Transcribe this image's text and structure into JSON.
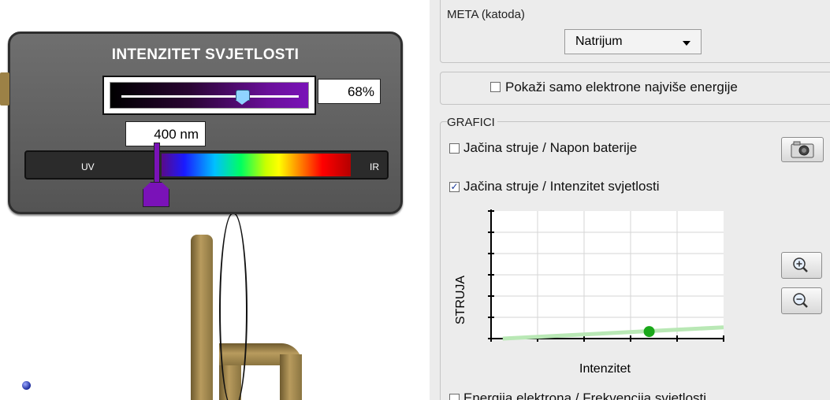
{
  "light_panel": {
    "title": "INTENZITET SVJETLOSTI",
    "intensity_value": "68%",
    "intensity_level": 0.68,
    "wavelength_value": "400 nm",
    "uv_label": "UV",
    "ir_label": "IR"
  },
  "side_panel": {
    "target_group": {
      "title": "META (katoda)",
      "selected": "Natrijum"
    },
    "show_highest_energy": {
      "label": "Pokaži samo elektrone najviše energije",
      "checked": false
    },
    "graphs_group": {
      "title": "GRAFICI",
      "options": [
        {
          "label": "Jačina struje / Napon baterije",
          "checked": false
        },
        {
          "label": "Jačina struje / Intenzitet svjetlosti",
          "checked": true
        },
        {
          "label": "Energija elektrona / Frekvencija svjetlosti",
          "checked": false
        }
      ]
    },
    "icons": {
      "camera": "camera-icon",
      "zoom_in": "zoom-in-icon",
      "zoom_out": "zoom-out-icon"
    }
  },
  "chart_data": {
    "type": "line",
    "xlabel": "Intenzitet",
    "ylabel": "STRUJA",
    "grid": true,
    "series": [
      {
        "x": [
          0,
          0.68
        ],
        "y": [
          0,
          0.08
        ]
      }
    ],
    "current_point": {
      "x": 0.68,
      "y": 0.055
    },
    "colors": {
      "line": "#b9e8b5",
      "point": "#1aa81a"
    }
  },
  "colors": {
    "panel_bg": "#5f5f5f",
    "sidebar_bg": "#ececec",
    "wavelength_marker": "#7a12b8"
  }
}
